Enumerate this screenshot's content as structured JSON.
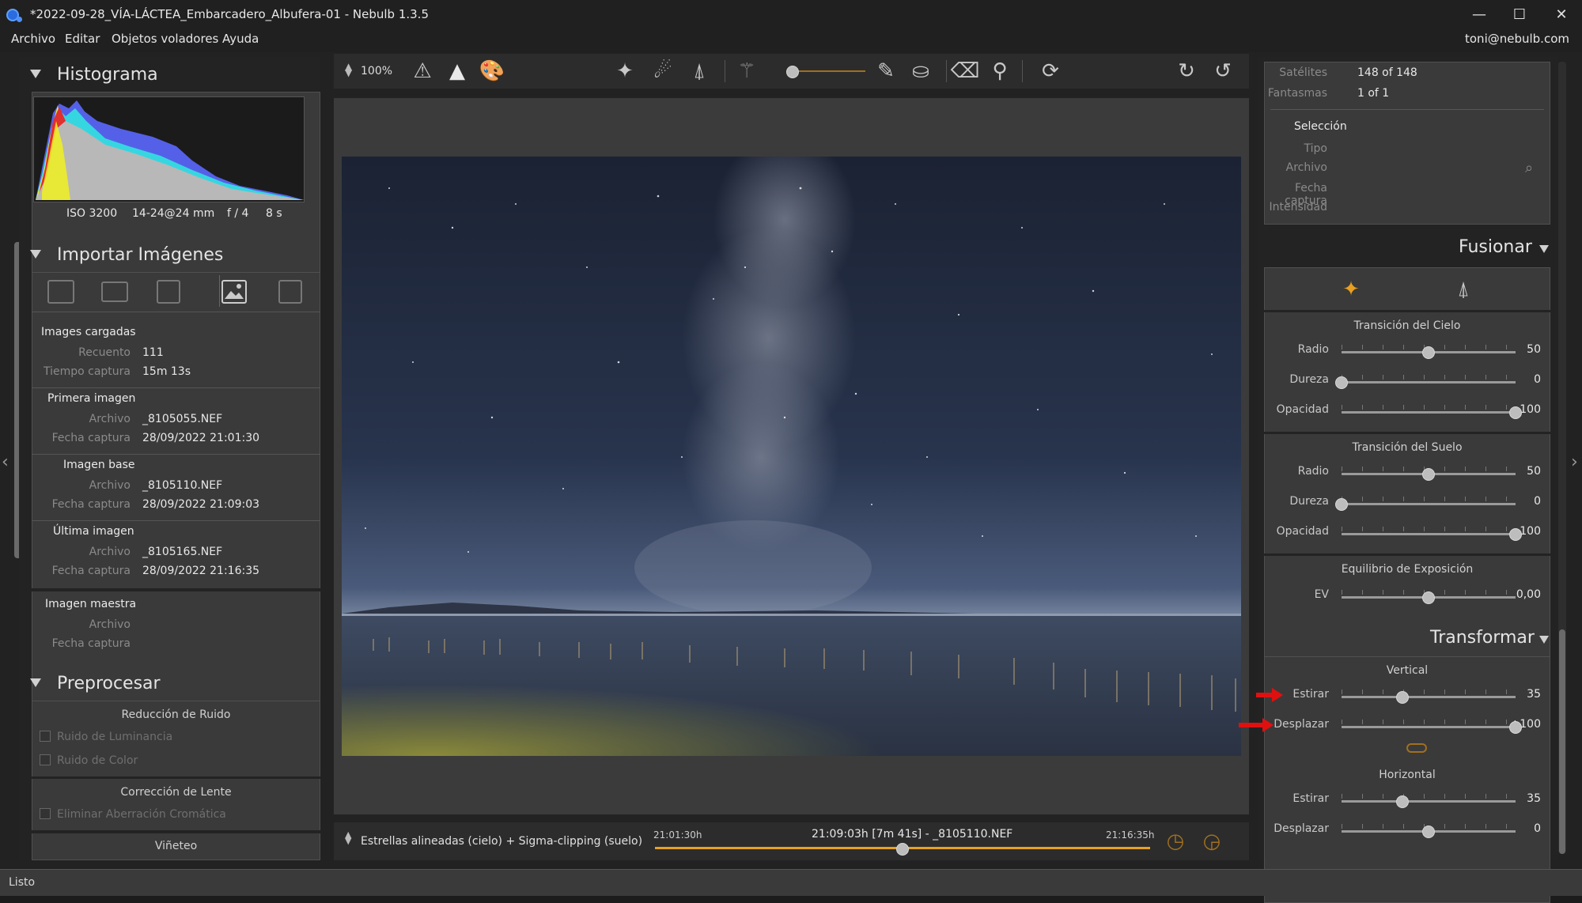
{
  "window": {
    "title": "*2022-09-28_VÍA-LÁCTEA_Embarcadero_Albufera-01 - Nebulb 1.3.5",
    "minimize": "—",
    "maximize": "☐",
    "close": "✕"
  },
  "menu": {
    "items": [
      "Archivo",
      "Editar",
      "Objetos voladores",
      "Ayuda"
    ],
    "user": "toni@nebulb.com"
  },
  "status": "Listo",
  "histogram": {
    "title": "Histograma",
    "iso": "ISO 3200",
    "lens": "14-24@24 mm",
    "aperture": "f / 4",
    "shutter": "8 s"
  },
  "import": {
    "title": "Importar Imágenes",
    "loaded": {
      "header": "Images cargadas",
      "count_label": "Recuento",
      "count": "111",
      "time_label": "Tiempo captura",
      "time": "15m 13s"
    },
    "first": {
      "header": "Primera imagen",
      "file_label": "Archivo",
      "file": "_8105055.NEF",
      "date_label": "Fecha captura",
      "date": "28/09/2022 21:01:30"
    },
    "base": {
      "header": "Imagen base",
      "file_label": "Archivo",
      "file": "_8105110.NEF",
      "date_label": "Fecha captura",
      "date": "28/09/2022 21:09:03"
    },
    "last": {
      "header": "Última imagen",
      "file_label": "Archivo",
      "file": "_8105165.NEF",
      "date_label": "Fecha captura",
      "date": "28/09/2022 21:16:35"
    },
    "master": {
      "header": "Imagen maestra",
      "file_label": "Archivo",
      "date_label": "Fecha captura"
    }
  },
  "preprocess": {
    "title": "Preprocesar",
    "noise_header": "Reducción de Ruido",
    "lum": "Ruido de Luminancia",
    "color": "Ruido de Color",
    "lens_header": "Corrección de Lente",
    "chroma": "Eliminar Aberración Cromática",
    "vignette": "Viñeteo"
  },
  "toolbar": {
    "zoom": "100%"
  },
  "timeline": {
    "mode": "Estrellas alineadas (cielo) + Sigma-clipping (suelo)",
    "start": "21:01:30h",
    "current": "21:09:03h [7m 41s] - _8105110.NEF",
    "end": "21:16:35h",
    "position": 0.5
  },
  "info": {
    "sat_label": "Satélites",
    "sat": "148 of 148",
    "ghost_label": "Fantasmas",
    "ghost": "1 of 1",
    "selection": "Selección",
    "type_label": "Tipo",
    "file_label": "Archivo",
    "date_label": "Fecha captura",
    "intensity_label": "Intensidad"
  },
  "merge": {
    "title": "Fusionar",
    "sky": {
      "header": "Transición del Cielo",
      "radio_label": "Radio",
      "radio": "50",
      "hard_label": "Dureza",
      "hard": "0",
      "opac_label": "Opacidad",
      "opac": "100"
    },
    "ground": {
      "header": "Transición del Suelo",
      "radio_label": "Radio",
      "radio": "50",
      "hard_label": "Dureza",
      "hard": "0",
      "opac_label": "Opacidad",
      "opac": "100"
    },
    "exposure": {
      "header": "Equilibrio de Exposición",
      "ev_label": "EV",
      "ev": "0,00"
    }
  },
  "transform": {
    "title": "Transformar",
    "vertical": {
      "header": "Vertical",
      "stretch_label": "Estirar",
      "stretch": "35",
      "shift_label": "Desplazar",
      "shift": "+100"
    },
    "horizontal": {
      "header": "Horizontal",
      "stretch_label": "Estirar",
      "stretch": "35",
      "shift_label": "Desplazar",
      "shift": "0"
    }
  },
  "colors": {
    "accent": "#e8a020",
    "red_arrow": "#e01010",
    "panel": "#3a3a3a"
  }
}
